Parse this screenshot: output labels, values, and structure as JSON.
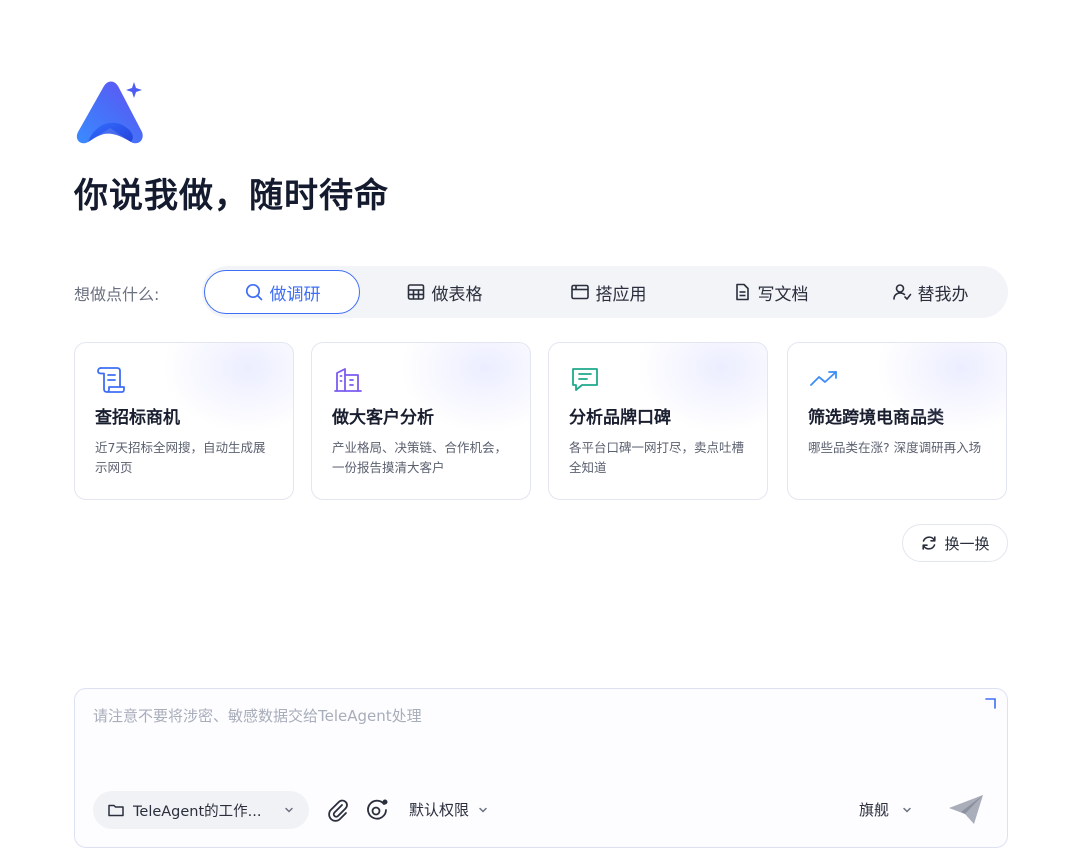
{
  "title": "你说我做，随时待命",
  "modes": {
    "prompt": "想做点什么:",
    "tabs": [
      {
        "label": "做调研",
        "icon": "search-icon",
        "active": true
      },
      {
        "label": "做表格",
        "icon": "table-icon",
        "active": false
      },
      {
        "label": "搭应用",
        "icon": "app-window-icon",
        "active": false
      },
      {
        "label": "写文档",
        "icon": "document-icon",
        "active": false
      },
      {
        "label": "替我办",
        "icon": "user-check-icon",
        "active": false
      }
    ]
  },
  "cards": [
    {
      "title": "查招标商机",
      "desc": "近7天招标全网搜，自动生成展示网页",
      "icon": "scroll-icon",
      "color": "#3e6ef5"
    },
    {
      "title": "做大客户分析",
      "desc": "产业格局、决策链、合作机会，一份报告摸清大客户",
      "icon": "building-icon",
      "color": "#7b5cf0"
    },
    {
      "title": "分析品牌口碑",
      "desc": "各平台口碑一网打尽，卖点吐槽全知道",
      "icon": "chat-icon",
      "color": "#1fa98a"
    },
    {
      "title": "筛选跨境电商品类",
      "desc": "哪些品类在涨? 深度调研再入场",
      "icon": "trend-up-icon",
      "color": "#3e8ef5"
    }
  ],
  "refresh_label": "换一换",
  "composer": {
    "placeholder": "请注意不要将涉密、敏感数据交给TeleAgent处理",
    "workspace_label": "TeleAgent的工作...",
    "permission_label": "默认权限",
    "model_label": "旗舰"
  },
  "colors": {
    "accent": "#3e6ef5",
    "text": "#141b2e",
    "muted": "#6b7080"
  }
}
